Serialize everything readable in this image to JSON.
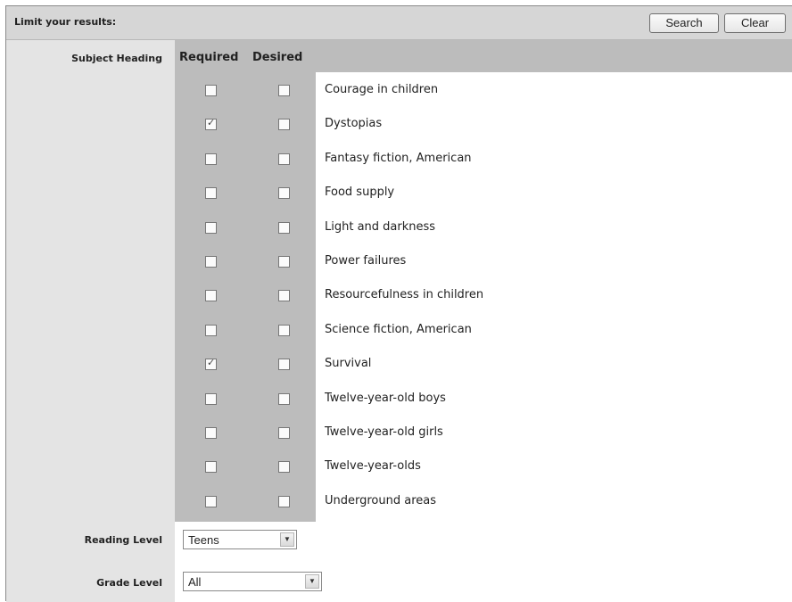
{
  "toolbar": {
    "title": "Limit your results:",
    "search_label": "Search",
    "clear_label": "Clear"
  },
  "subject": {
    "label": "Subject Heading",
    "required_header": "Required",
    "desired_header": "Desired",
    "items": [
      {
        "text": "Courage in children",
        "required": false,
        "desired": false
      },
      {
        "text": "Dystopias",
        "required": true,
        "desired": false
      },
      {
        "text": "Fantasy fiction, American",
        "required": false,
        "desired": false
      },
      {
        "text": "Food supply",
        "required": false,
        "desired": false
      },
      {
        "text": "Light and darkness",
        "required": false,
        "desired": false
      },
      {
        "text": "Power failures",
        "required": false,
        "desired": false
      },
      {
        "text": "Resourcefulness in children",
        "required": false,
        "desired": false
      },
      {
        "text": "Science fiction, American",
        "required": false,
        "desired": false
      },
      {
        "text": "Survival",
        "required": true,
        "desired": false
      },
      {
        "text": "Twelve-year-old boys",
        "required": false,
        "desired": false
      },
      {
        "text": "Twelve-year-old girls",
        "required": false,
        "desired": false
      },
      {
        "text": "Twelve-year-olds",
        "required": false,
        "desired": false
      },
      {
        "text": "Underground areas",
        "required": false,
        "desired": false
      }
    ]
  },
  "reading_level": {
    "label": "Reading Level",
    "value": "Teens"
  },
  "grade_level": {
    "label": "Grade Level",
    "value": "All"
  },
  "icons": {
    "check": "check-icon",
    "dropdown": "chevron-down-icon"
  }
}
